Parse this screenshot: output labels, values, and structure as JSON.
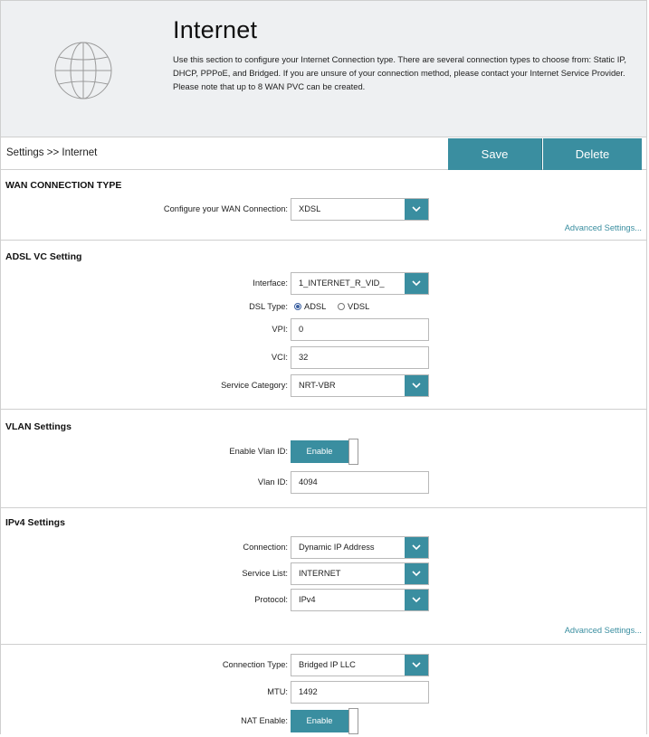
{
  "header": {
    "title": "Internet",
    "description": "Use this section to configure your Internet Connection type. There are several connection types to choose from: Static IP, DHCP, PPPoE, and Bridged. If you are unsure of your connection method, please contact your Internet Service Provider. Please note that up to 8 WAN PVC can be created.",
    "icon": "globe-icon"
  },
  "toolbar": {
    "breadcrumb": "Settings >> Internet",
    "save_label": "Save",
    "delete_label": "Delete",
    "accent_color": "#3a8ea0"
  },
  "wan": {
    "heading": "WAN CONNECTION TYPE",
    "configure_label": "Configure your WAN Connection:",
    "configure_value": "XDSL",
    "advanced_link": "Advanced Settings..."
  },
  "adsl": {
    "heading": "ADSL VC Setting",
    "interface_label": "Interface:",
    "interface_value": "1_INTERNET_R_VID_",
    "dsl_type_label": "DSL Type:",
    "dsl_options": [
      "ADSL",
      "VDSL"
    ],
    "dsl_selected": "ADSL",
    "vpi_label": "VPI:",
    "vpi_value": "0",
    "vci_label": "VCI:",
    "vci_value": "32",
    "service_category_label": "Service Category:",
    "service_category_value": "NRT-VBR"
  },
  "vlan": {
    "heading": "VLAN Settings",
    "enable_label": "Enable Vlan ID:",
    "enable_toggle": "Enable",
    "vlan_id_label": "Vlan ID:",
    "vlan_id_value": "4094"
  },
  "ipv4": {
    "heading": "IPv4 Settings",
    "connection_label": "Connection:",
    "connection_value": "Dynamic IP Address",
    "service_list_label": "Service List:",
    "service_list_value": "INTERNET",
    "protocol_label": "Protocol:",
    "protocol_value": "IPv4",
    "advanced_link": "Advanced Settings..."
  },
  "advanced": {
    "connection_type_label": "Connection Type:",
    "connection_type_value": "Bridged IP LLC",
    "mtu_label": "MTU:",
    "mtu_value": "1492",
    "nat_label": "NAT Enable:",
    "nat_toggle": "Enable"
  }
}
